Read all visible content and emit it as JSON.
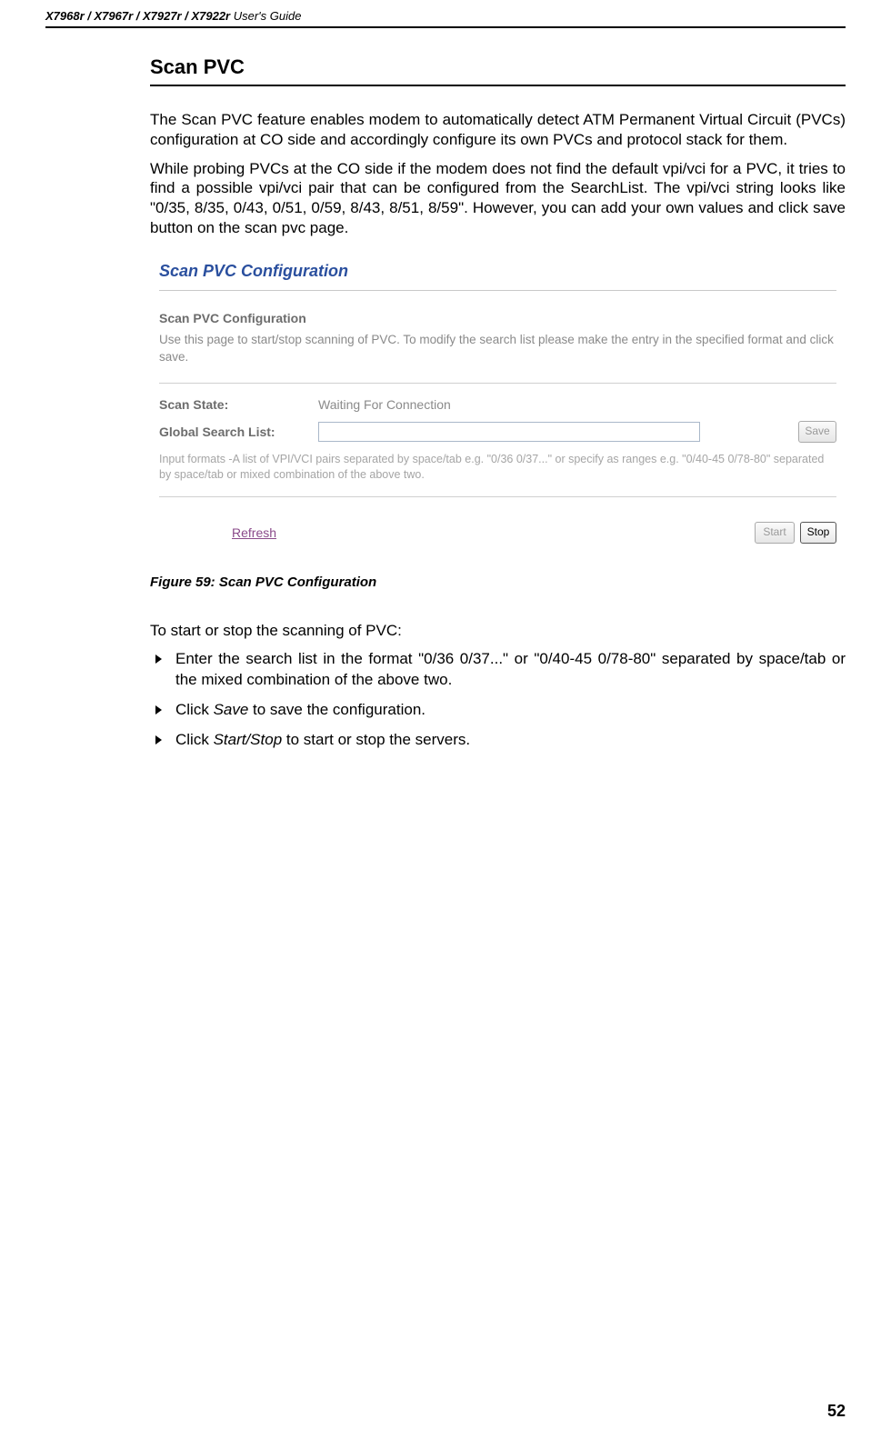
{
  "header": {
    "models": "X7968r / X7967r / X7927r / X7922r",
    "guide": " User's Guide"
  },
  "section_title": "Scan PVC",
  "para1": "The Scan PVC feature enables modem to automatically detect ATM Permanent Virtual Circuit (PVCs) configuration at CO side and accordingly configure its own PVCs and protocol stack for them.",
  "para2": "While probing PVCs at the CO side if the modem does not find the default vpi/vci for a PVC, it tries to find a possible vpi/vci pair that can be configured from the SearchList. The vpi/vci string looks like \"0/35, 8/35, 0/43, 0/51, 0/59, 8/43, 8/51, 8/59\". However, you can add your own values and click save button on the scan pvc page.",
  "screenshot": {
    "title": "Scan PVC Configuration",
    "subtitle": "Scan PVC Configuration",
    "desc": "Use this page to start/stop scanning of PVC. To modify the search list please make the entry in the specified format and click save.",
    "state_label": "Scan State:",
    "state_value": "Waiting For Connection",
    "list_label": "Global Search List:",
    "list_value": "",
    "save": "Save",
    "hint": "Input formats -A list of VPI/VCI pairs separated by space/tab e.g. \"0/36 0/37...\" or specify as ranges e.g. \"0/40-45 0/78-80\" separated by space/tab or mixed combination of the above two.",
    "refresh": "Refresh",
    "start": "Start",
    "stop": "Stop"
  },
  "figure_caption": "Figure 59: Scan PVC Configuration",
  "instr_intro": "To start or stop the scanning of PVC:",
  "bullets": {
    "b1": "Enter the search list in the format \"0/36 0/37...\" or \"0/40-45 0/78-80\" separated by space/tab or the mixed combination of the above two.",
    "b2_pre": "Click ",
    "b2_em": "Save",
    "b2_post": " to save the configuration.",
    "b3_pre": "Click ",
    "b3_em": "Start/Stop",
    "b3_post": " to start or stop the servers."
  },
  "page_number": "52"
}
